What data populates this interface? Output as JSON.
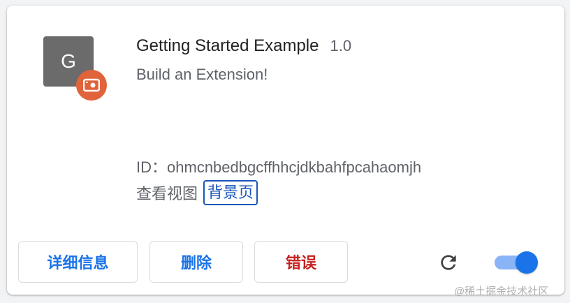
{
  "extension": {
    "icon_letter": "G",
    "badge_icon": "camera-badge-icon",
    "name": "Getting Started Example",
    "version": "1.0",
    "description": "Build an Extension!",
    "id_label": "ID：",
    "id_value": "ohmcnbedbgcffhhcjdkbahfpcahaomjh",
    "inspect_label": "查看视图",
    "inspect_link": "背景页",
    "enabled": true
  },
  "actions": {
    "details_label": "详细信息",
    "remove_label": "删除",
    "errors_label": "错误",
    "reload_icon": "reload-icon"
  },
  "watermark": "@稀土掘金技术社区",
  "colors": {
    "accent": "#1a73e8",
    "error": "#c5221f",
    "badge": "#e0633b",
    "icon_bg": "#6b6b6b"
  }
}
